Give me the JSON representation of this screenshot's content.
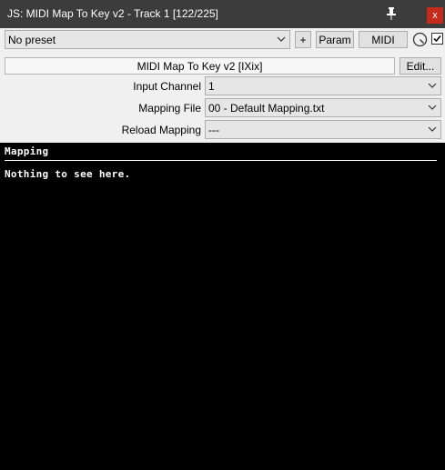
{
  "window": {
    "title": "JS: MIDI Map To Key v2 - Track 1 [122/225]",
    "pin_icon": "pin-icon",
    "close_label": "x"
  },
  "toolbar": {
    "preset_value": "No preset",
    "plus_label": "+",
    "param_label": "Param",
    "midi_label": "MIDI",
    "wet_knob_icon": "knob-icon",
    "enable_checked": true
  },
  "plugin": {
    "name": "MIDI Map To Key v2 [IXix]",
    "edit_label": "Edit..."
  },
  "params": [
    {
      "label": "Input Channel",
      "value": "1"
    },
    {
      "label": "Mapping File",
      "value": "00 - Default Mapping.txt"
    },
    {
      "label": "Reload Mapping",
      "value": "---"
    }
  ],
  "display": {
    "heading": "Mapping",
    "message": "Nothing to see here."
  },
  "colors": {
    "titlebar": "#3c3c3c",
    "close": "#c42b1c",
    "panel": "#f0f0f0",
    "canvas": "#000000"
  }
}
